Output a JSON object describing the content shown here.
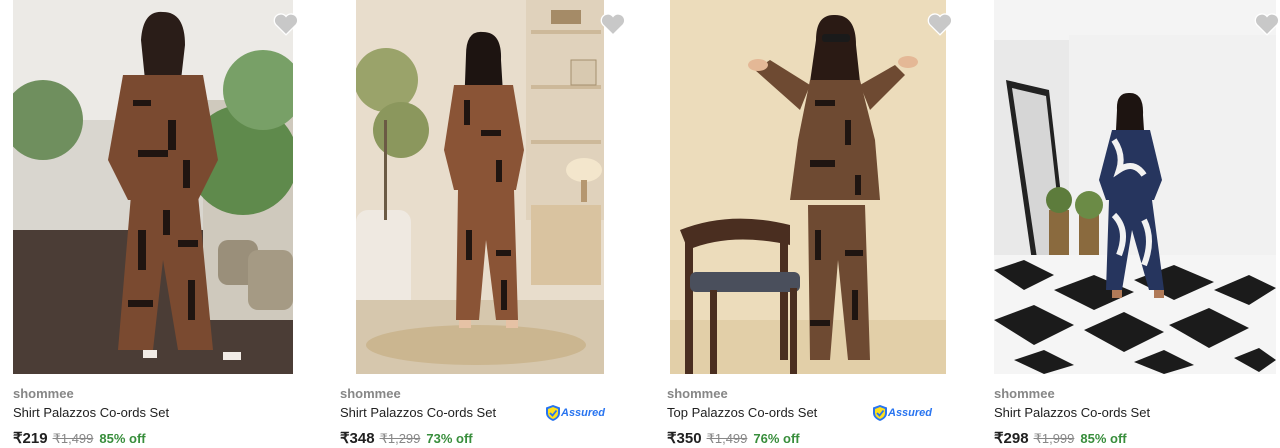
{
  "products": [
    {
      "brand": "shommee",
      "title": "Shirt Palazzos Co-ords Set",
      "price": "₹219",
      "mrp": "₹1,499",
      "discount": "85% off",
      "assured": false,
      "image_icon": "product-photo-icon",
      "outfit_color": "#7a4a30"
    },
    {
      "brand": "shommee",
      "title": "Shirt Palazzos Co-ords Set",
      "price": "₹348",
      "mrp": "₹1,299",
      "discount": "73% off",
      "assured": true,
      "assured_label": "Assured",
      "image_icon": "product-photo-icon",
      "outfit_color": "#8a5436"
    },
    {
      "brand": "",
      "title": "Top Palazzos Co-ords Set",
      "price": "₹350",
      "mrp": "₹1,499",
      "discount": "76% off",
      "assured": true,
      "assured_label": "Assured",
      "image_icon": "product-photo-icon",
      "outfit_color": "#6e4a32"
    },
    {
      "brand": "shommee",
      "title": "Shirt Palazzos Co-ords Set",
      "price": "₹298",
      "mrp": "₹1,999",
      "discount": "85% off",
      "assured": false,
      "image_icon": "product-photo-icon",
      "outfit_color": "#26355e"
    }
  ],
  "third_brand": "shommee",
  "colors": {
    "discount": "#388e3c",
    "assured": "#2874f0",
    "brand_text": "#878787"
  }
}
